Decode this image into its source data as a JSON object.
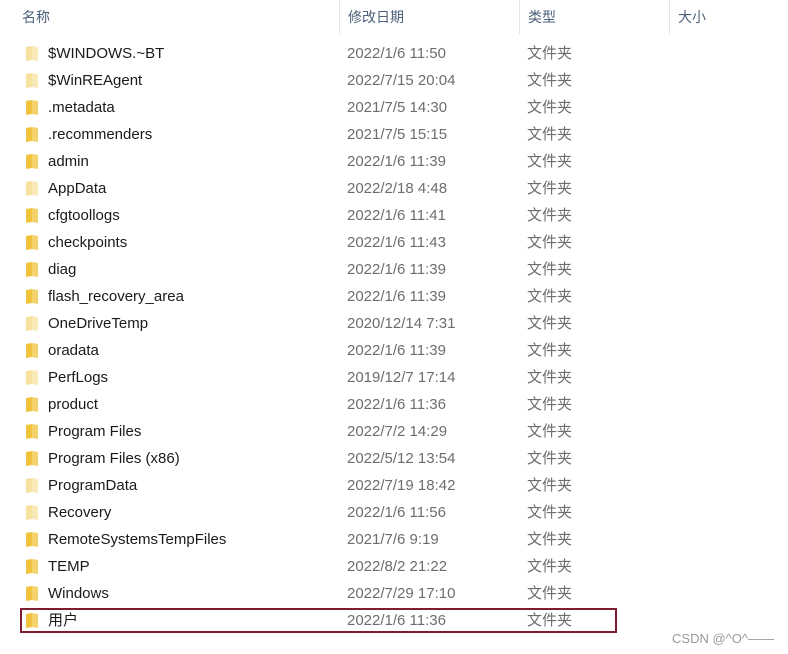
{
  "header": {
    "name": "名称",
    "date": "修改日期",
    "type": "类型",
    "size": "大小"
  },
  "rows": [
    {
      "name": "$WINDOWS.~BT",
      "date": "2022/1/6 11:50",
      "type": "文件夹",
      "icon": "folder-faded"
    },
    {
      "name": "$WinREAgent",
      "date": "2022/7/15 20:04",
      "type": "文件夹",
      "icon": "folder-faded"
    },
    {
      "name": ".metadata",
      "date": "2021/7/5 14:30",
      "type": "文件夹",
      "icon": "folder"
    },
    {
      "name": ".recommenders",
      "date": "2021/7/5 15:15",
      "type": "文件夹",
      "icon": "folder"
    },
    {
      "name": "admin",
      "date": "2022/1/6 11:39",
      "type": "文件夹",
      "icon": "folder"
    },
    {
      "name": "AppData",
      "date": "2022/2/18 4:48",
      "type": "文件夹",
      "icon": "folder-faded"
    },
    {
      "name": "cfgtoollogs",
      "date": "2022/1/6 11:41",
      "type": "文件夹",
      "icon": "folder"
    },
    {
      "name": "checkpoints",
      "date": "2022/1/6 11:43",
      "type": "文件夹",
      "icon": "folder"
    },
    {
      "name": "diag",
      "date": "2022/1/6 11:39",
      "type": "文件夹",
      "icon": "folder"
    },
    {
      "name": "flash_recovery_area",
      "date": "2022/1/6 11:39",
      "type": "文件夹",
      "icon": "folder"
    },
    {
      "name": "OneDriveTemp",
      "date": "2020/12/14 7:31",
      "type": "文件夹",
      "icon": "folder-faded"
    },
    {
      "name": "oradata",
      "date": "2022/1/6 11:39",
      "type": "文件夹",
      "icon": "folder"
    },
    {
      "name": "PerfLogs",
      "date": "2019/12/7 17:14",
      "type": "文件夹",
      "icon": "folder-faded"
    },
    {
      "name": "product",
      "date": "2022/1/6 11:36",
      "type": "文件夹",
      "icon": "folder"
    },
    {
      "name": "Program Files",
      "date": "2022/7/2 14:29",
      "type": "文件夹",
      "icon": "folder"
    },
    {
      "name": "Program Files (x86)",
      "date": "2022/5/12 13:54",
      "type": "文件夹",
      "icon": "folder"
    },
    {
      "name": "ProgramData",
      "date": "2022/7/19 18:42",
      "type": "文件夹",
      "icon": "folder-faded"
    },
    {
      "name": "Recovery",
      "date": "2022/1/6 11:56",
      "type": "文件夹",
      "icon": "folder-faded"
    },
    {
      "name": "RemoteSystemsTempFiles",
      "date": "2021/7/6 9:19",
      "type": "文件夹",
      "icon": "folder"
    },
    {
      "name": "TEMP",
      "date": "2022/8/2 21:22",
      "type": "文件夹",
      "icon": "folder"
    },
    {
      "name": "Windows",
      "date": "2022/7/29 17:10",
      "type": "文件夹",
      "icon": "folder"
    },
    {
      "name": "用户",
      "date": "2022/1/6 11:36",
      "type": "文件夹",
      "icon": "folder",
      "highlighted": true
    }
  ],
  "colors": {
    "folder": "#f0c33c",
    "folder_faded": "#f7e2a0",
    "highlight_border": "#7d1d30",
    "header_text": "#4c607a"
  },
  "watermark": "CSDN @^O^——"
}
